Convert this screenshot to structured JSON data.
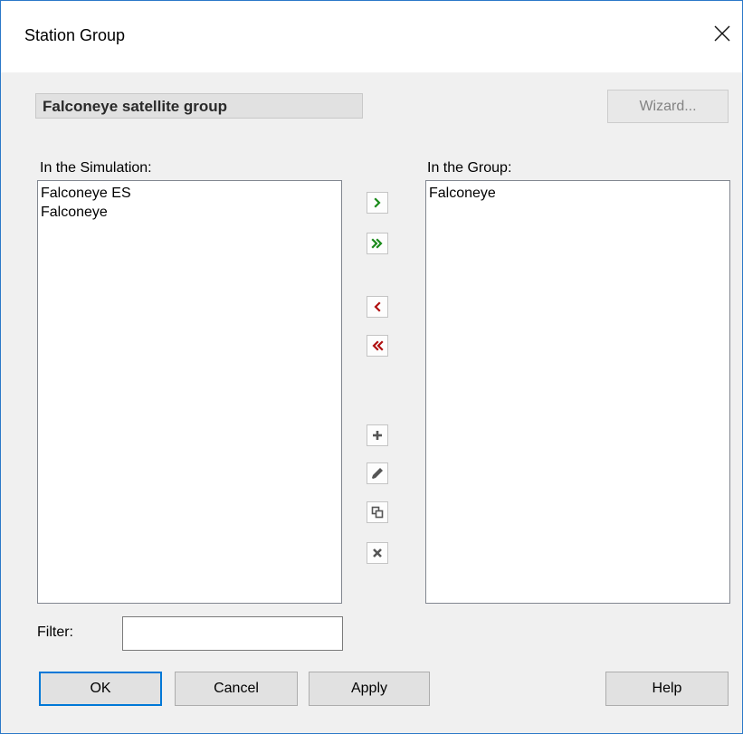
{
  "window": {
    "title": "Station Group",
    "close_icon": "close-icon"
  },
  "group": {
    "name": "Falconeye satellite group",
    "wizard_label": "Wizard..."
  },
  "simulation_list": {
    "label": "In the Simulation:",
    "items": [
      "Falconeye ES",
      "Falconeye"
    ]
  },
  "group_list": {
    "label": "In the Group:",
    "items": [
      "Falconeye"
    ]
  },
  "transfer_buttons": {
    "add_one": "chevron-right-icon",
    "add_all": "double-chevron-right-icon",
    "remove_one": "chevron-left-icon",
    "remove_all": "double-chevron-left-icon",
    "new": "plus-icon",
    "edit": "pencil-icon",
    "duplicate": "duplicate-icon",
    "delete": "x-icon",
    "add_color": "#1a8a1a",
    "remove_color": "#b01010",
    "tool_color": "#555555"
  },
  "filter": {
    "label": "Filter:",
    "value": "",
    "placeholder": ""
  },
  "footer": {
    "ok": "OK",
    "cancel": "Cancel",
    "apply": "Apply",
    "help": "Help"
  }
}
